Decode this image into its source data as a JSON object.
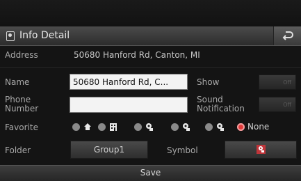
{
  "header": {
    "title": "Info Detail"
  },
  "form": {
    "address_label": "Address",
    "address_value": "50680 Hanford Rd, Canton, MI",
    "name_label": "Name",
    "name_value": "50680 Hanford Rd, C...",
    "show_label": "Show",
    "show_toggle": "Off",
    "phone_label_line1": "Phone",
    "phone_label_line2": "Number",
    "phone_value": "",
    "sound_label_line1": "Sound",
    "sound_label_line2": "Notification",
    "sound_toggle": "Off",
    "favorite_label": "Favorite",
    "favorite_options": [
      {
        "icon": "home-icon"
      },
      {
        "icon": "building-icon"
      },
      {
        "icon": "favorite-1-icon"
      },
      {
        "icon": "favorite-2-icon"
      },
      {
        "icon": "favorite-3-icon"
      },
      {
        "label": "None",
        "selected": true
      }
    ],
    "folder_label": "Folder",
    "folder_value": "Group1",
    "symbol_label": "Symbol"
  },
  "footer": {
    "save_label": "Save"
  },
  "colors": {
    "selected_radio": "#e23a3a",
    "symbol_button": "#c0353a",
    "input_bg": "#f3f3f3"
  }
}
